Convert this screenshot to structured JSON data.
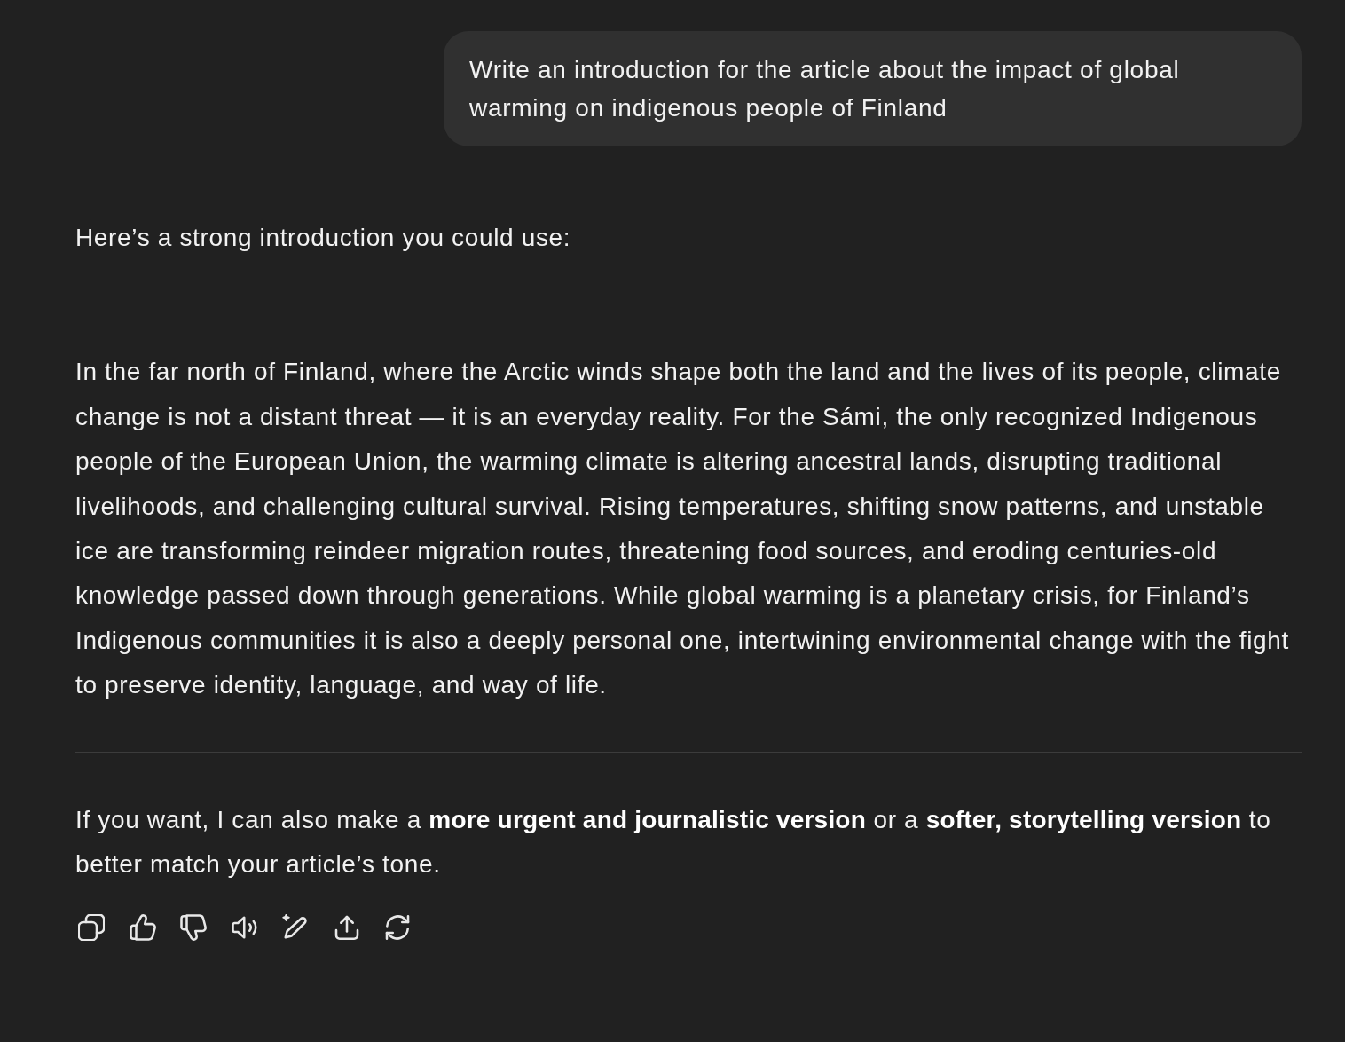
{
  "user_message": {
    "text": "Write an introduction for the article about the impact of global warming on indigenous people of Finland"
  },
  "assistant_message": {
    "blocks": [
      {
        "kind": "text",
        "text": "Here’s a strong introduction you could use:"
      },
      {
        "kind": "rule"
      },
      {
        "kind": "text",
        "text": "In the far north of Finland, where the Arctic winds shape both the land and the lives of its people, climate change is not a distant threat — it is an everyday reality. For the Sámi, the only recognized Indigenous people of the European Union, the warming climate is altering ancestral lands, disrupting traditional livelihoods, and challenging cultural survival. Rising temperatures, shifting snow patterns, and unstable ice are transforming reindeer migration routes, threatening food sources, and eroding centuries-old knowledge passed down through generations. While global warming is a planetary crisis, for Finland’s Indigenous communities it is also a deeply personal one, intertwining environmental change with the fight to preserve identity, language, and way of life."
      },
      {
        "kind": "rule"
      },
      {
        "kind": "text",
        "text": "If you want, I can also make a **more urgent and journalistic version** or a **softer, storytelling version** to better match your article’s tone."
      }
    ]
  }
}
